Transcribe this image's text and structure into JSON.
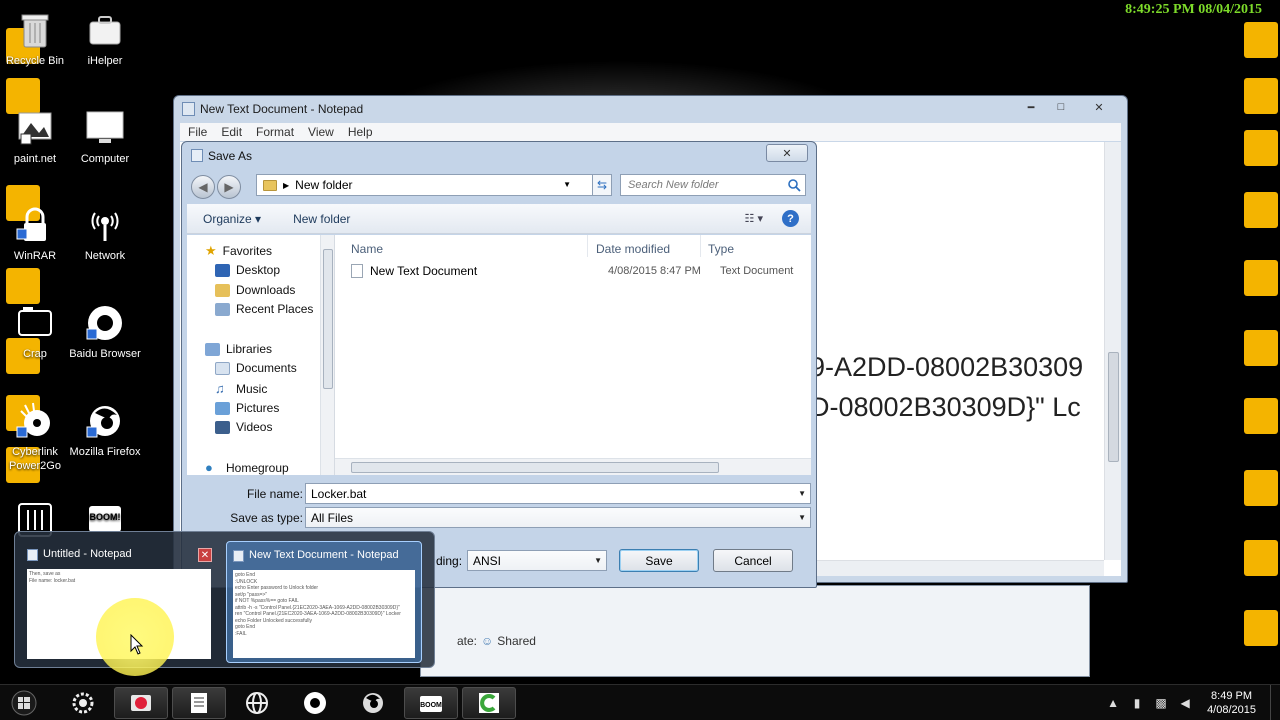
{
  "desktop": {
    "clock_top": "8:49:25 PM 08/04/2015",
    "icons": [
      {
        "label": "Recycle Bin",
        "icon": "recycle-bin-icon"
      },
      {
        "label": "iHelper",
        "icon": "ihelper-icon"
      },
      {
        "label": "paint.net",
        "icon": "paintnet-icon"
      },
      {
        "label": "Computer",
        "icon": "computer-icon"
      },
      {
        "label": "WinRAR",
        "icon": "winrar-icon"
      },
      {
        "label": "Network",
        "icon": "network-icon"
      },
      {
        "label": "Crap",
        "icon": "folder-icon"
      },
      {
        "label": "Baidu Browser",
        "icon": "baidu-browser-icon"
      },
      {
        "label": "Cyberlink Power2Go",
        "icon": "power2go-icon"
      },
      {
        "label": "Mozilla Firefox",
        "icon": "firefox-icon"
      }
    ]
  },
  "notepad": {
    "title": "New Text Document - Notepad",
    "menu": [
      "File",
      "Edit",
      "Format",
      "View",
      "Help"
    ],
    "controls": {
      "minimize": "━",
      "maximize": "□",
      "close": "✕"
    },
    "visible_lines": [
      "9-A2DD-08002B30309",
      "D-08002B30309D}\" Lc"
    ]
  },
  "background_window": {
    "shared_label": "Shared",
    "partial_label": "ate:"
  },
  "save_as": {
    "title": "Save As",
    "close": "✕",
    "address": "New folder",
    "search_placeholder": "Search New folder",
    "toolbar": {
      "organize": "Organize ▾",
      "new_folder": "New folder",
      "views": "☷  ▾",
      "help": "?"
    },
    "nav": {
      "favorites": "Favorites",
      "desktop": "Desktop",
      "downloads": "Downloads",
      "recent": "Recent Places",
      "libraries": "Libraries",
      "documents": "Documents",
      "music": "Music",
      "pictures": "Pictures",
      "videos": "Videos",
      "homegroup": "Homegroup"
    },
    "columns": {
      "name": "Name",
      "date": "Date modified",
      "type": "Type"
    },
    "files": [
      {
        "name": "New Text Document",
        "date": "4/08/2015 8:47 PM",
        "type": "Text Document"
      }
    ],
    "file_name_label": "File name:",
    "file_name_value": "Locker.bat",
    "save_type_label": "Save as type:",
    "save_type_value": "All Files",
    "encoding_label": "ding:",
    "encoding_value": "ANSI",
    "save_button": "Save",
    "cancel_button": "Cancel"
  },
  "thumbnails": [
    {
      "title": "Untitled - Notepad",
      "close": "✕",
      "preview": [
        "Then, save as",
        "File name: locker.bat"
      ]
    },
    {
      "title": "New Text Document - Notepad",
      "preview": [
        "goto End",
        ":UNLOCK",
        "echo Enter password to Unlock folder",
        "set/p \"pass=>\"",
        "if NOT %pass%== goto FAIL",
        "attrib -h -s \"Control Panel.{21EC2020-3AEA-1069-A2DD-08002B30309D}\"",
        "ren \"Control Panel.{21EC2020-3AEA-1069-A2DD-08002B30309D}\" Locker",
        "echo Folder Unlocked successfully",
        "goto End",
        ":FAIL"
      ]
    }
  ],
  "taskbar": {
    "apps": [
      "start-orb-icon",
      "settings-icon",
      "recorder-icon",
      "notepad-icon",
      "globe-icon",
      "baidu-icon",
      "firefox-icon",
      "boom-icon",
      "camtasia-icon"
    ],
    "time": "8:49 PM",
    "date": "4/08/2015"
  }
}
